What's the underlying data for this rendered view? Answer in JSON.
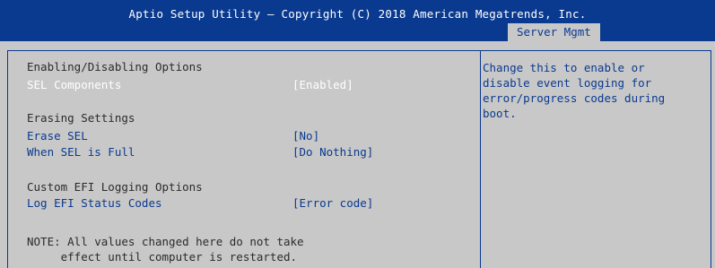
{
  "header": {
    "title": "Aptio Setup Utility – Copyright (C) 2018 American Megatrends, Inc.",
    "active_tab": "Server Mgmt"
  },
  "settings": {
    "section_enable": "Enabling/Disabling Options",
    "sel_components": {
      "label": "SEL Components",
      "value": "[Enabled]"
    },
    "section_erase": "Erasing Settings",
    "erase_sel": {
      "label": "Erase SEL",
      "value": "[No]"
    },
    "when_sel_full": {
      "label": "When SEL is Full",
      "value": "[Do Nothing]"
    },
    "section_custom": "Custom EFI Logging Options",
    "log_efi_status": {
      "label": "Log EFI Status Codes",
      "value": "[Error code]"
    },
    "note": "NOTE: All values changed here do not take\n     effect until computer is restarted."
  },
  "help": {
    "text": "Change this to enable or\ndisable event logging for\nerror/progress codes during\nboot."
  },
  "colors": {
    "accent": "#0a3a8f",
    "background": "#c8c8c8",
    "selected_text": "#ffffff"
  }
}
